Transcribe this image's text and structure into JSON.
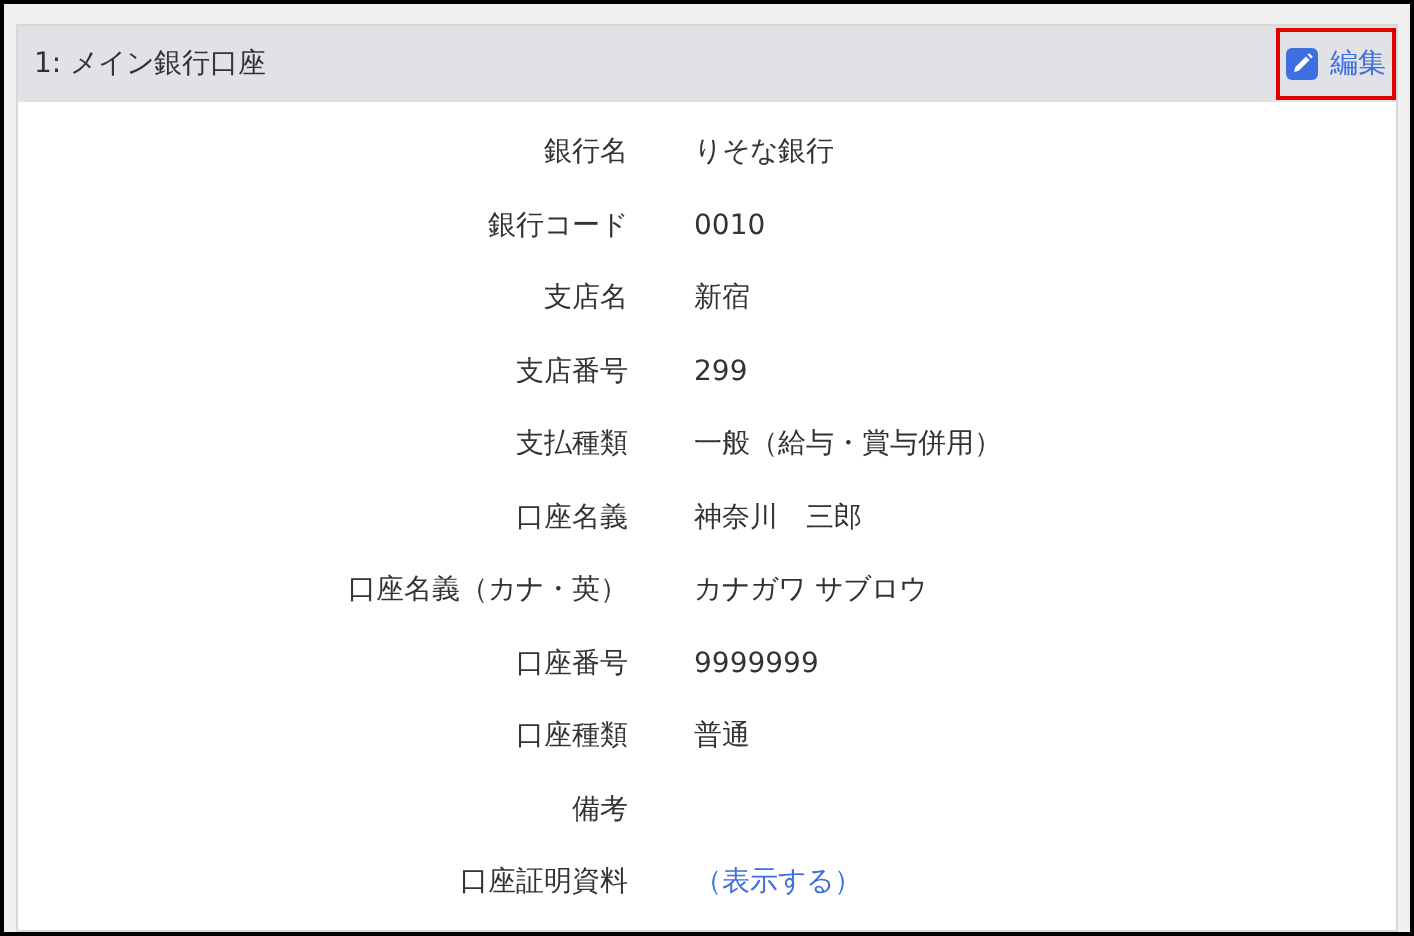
{
  "panel": {
    "title": "1: メイン銀行口座",
    "edit_button": {
      "label": "編集",
      "highlighted": true
    }
  },
  "fields": [
    {
      "label": "銀行名",
      "value": "りそな銀行",
      "kind": "text"
    },
    {
      "label": "銀行コード",
      "value": "0010",
      "kind": "text"
    },
    {
      "label": "支店名",
      "value": "新宿",
      "kind": "text"
    },
    {
      "label": "支店番号",
      "value": "299",
      "kind": "text"
    },
    {
      "label": "支払種類",
      "value": "一般（給与・賞与併用）",
      "kind": "text"
    },
    {
      "label": "口座名義",
      "value": "神奈川　三郎",
      "kind": "text"
    },
    {
      "label": "口座名義（カナ・英）",
      "value": "カナガワ サブロウ",
      "kind": "text"
    },
    {
      "label": "口座番号",
      "value": "9999999",
      "kind": "text"
    },
    {
      "label": "口座種類",
      "value": "普通",
      "kind": "text"
    },
    {
      "label": "備考"
    },
    {
      "label": "口座証明資料",
      "value": "（表示する）",
      "kind": "link"
    }
  ]
}
